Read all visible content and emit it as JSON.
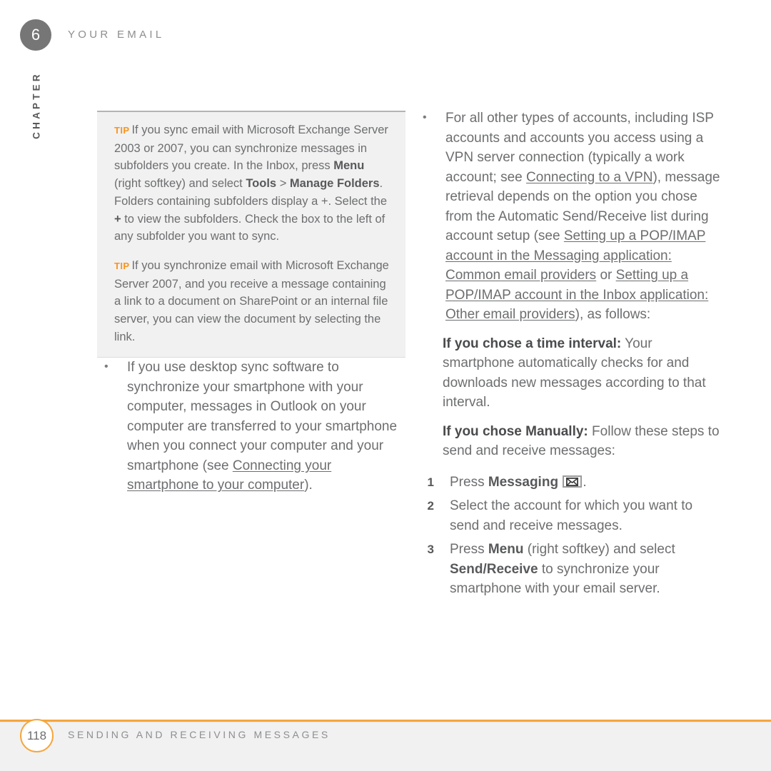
{
  "header": {
    "chapter_number": "6",
    "running_head": "YOUR EMAIL",
    "chapter_word": "CHAPTER"
  },
  "left_column": {
    "tip_box": {
      "label": "TIP",
      "paragraphs": [
        {
          "runs": [
            {
              "text": "TIP",
              "style": "tip-label"
            },
            {
              "text": "If you sync email with Microsoft Exchange Server 2003 or 2007, you can synchronize messages in subfolders you create. In the Inbox, press ",
              "style": "normal"
            },
            {
              "text": "Menu",
              "style": "bold"
            },
            {
              "text": " (right softkey) and select ",
              "style": "normal"
            },
            {
              "text": "Tools",
              "style": "bold"
            },
            {
              "text": " > ",
              "style": "normal"
            },
            {
              "text": "Manage Folders",
              "style": "bold"
            },
            {
              "text": ". Folders containing subfolders display a +. Select the ",
              "style": "normal"
            },
            {
              "text": "+",
              "style": "bold"
            },
            {
              "text": " to view the subfolders. Check the box to the left of any subfolder you want to sync.",
              "style": "normal"
            }
          ]
        },
        {
          "runs": [
            {
              "text": "TIP",
              "style": "tip-label"
            },
            {
              "text": "If you synchronize email with Microsoft Exchange Server 2007, and you receive a message containing a link to a document on SharePoint or an internal file server, you can view the document by selecting the link.",
              "style": "normal"
            }
          ]
        }
      ]
    },
    "bullets": [
      {
        "runs": [
          {
            "text": "If you use desktop sync software to synchronize your smartphone with your computer, messages in Outlook on your computer are transferred to your smartphone when you connect your computer and your smartphone (see ",
            "style": "normal"
          },
          {
            "text": "Connecting your smartphone to your computer",
            "style": "link"
          },
          {
            "text": ").",
            "style": "normal"
          }
        ]
      }
    ]
  },
  "right_column": {
    "bullets": [
      {
        "runs": [
          {
            "text": "For all other types of accounts, including ISP accounts and accounts you access using a VPN server connection (typically a work account; see ",
            "style": "normal"
          },
          {
            "text": "Connecting to a VPN",
            "style": "link"
          },
          {
            "text": "), message retrieval depends on the option you chose from the Automatic Send/Receive list during account setup (see ",
            "style": "normal"
          },
          {
            "text": "Setting up a POP/IMAP account in the Messaging application: Common email providers",
            "style": "link"
          },
          {
            "text": " or ",
            "style": "normal"
          },
          {
            "text": "Setting up a POP/IMAP account in the Inbox application: Other email providers",
            "style": "link"
          },
          {
            "text": "), as follows:",
            "style": "normal"
          }
        ]
      }
    ],
    "sub_paragraphs": [
      {
        "lead": "If you chose a time interval:",
        "body": " Your smartphone automatically checks for and downloads new messages according to that interval."
      },
      {
        "lead": "If you chose Manually:",
        "body": " Follow these steps to send and receive messages:"
      }
    ],
    "steps": [
      {
        "number": "1",
        "runs": [
          {
            "text": "Press ",
            "style": "normal"
          },
          {
            "text": "Messaging",
            "style": "bold"
          },
          {
            "text": " ",
            "style": "normal"
          },
          {
            "text": "envelope-key-icon",
            "style": "keycap"
          },
          {
            "text": ".",
            "style": "normal"
          }
        ]
      },
      {
        "number": "2",
        "runs": [
          {
            "text": "Select the account for which you want to send and receive messages.",
            "style": "normal"
          }
        ]
      },
      {
        "number": "3",
        "runs": [
          {
            "text": "Press ",
            "style": "normal"
          },
          {
            "text": "Menu",
            "style": "bold"
          },
          {
            "text": " (right softkey) and select ",
            "style": "normal"
          },
          {
            "text": "Send/Receive",
            "style": "bold"
          },
          {
            "text": " to synchronize your smartphone with your email server.",
            "style": "normal"
          }
        ]
      }
    ]
  },
  "footer": {
    "page_number": "118",
    "title": "SENDING AND RECEIVING MESSAGES"
  },
  "colors": {
    "accent_orange": "#f5a63c",
    "tip_orange": "#f7941e",
    "body_text": "#6d6e70",
    "bold_text": "#58595b",
    "chapter_badge": "#767676",
    "tip_bg": "#f1f1f1"
  }
}
